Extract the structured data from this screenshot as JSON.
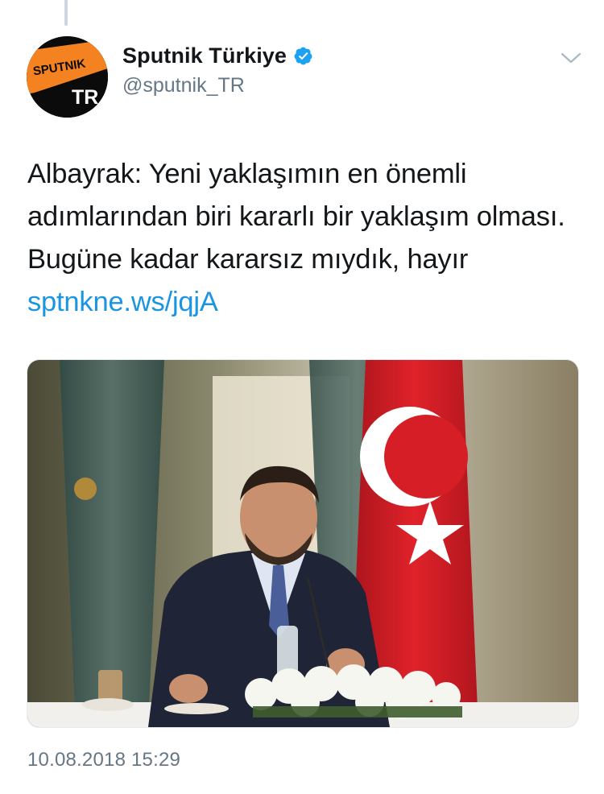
{
  "tweet": {
    "author": {
      "display_name": "Sputnik Türkiye",
      "handle": "@sputnik_TR",
      "verified": true,
      "avatar": {
        "logo_text": "SPUTNIK",
        "region_text": "TR",
        "brand_color": "#f58220"
      }
    },
    "text": "Albayrak: Yeni yaklaşımın en önemli adımlarından biri kararlı bir yaklaşım olması. Bugüne kadar kararsız mıydık, hayır",
    "link": "sptnkne.ws/jqjA",
    "timestamp": "10.08.2018 15:29",
    "media": {
      "type": "photo",
      "icon": "photo-icon"
    }
  },
  "colors": {
    "text_primary": "#14171a",
    "text_secondary": "#657786",
    "link": "#1b95e0",
    "verified": "#1da1f2"
  }
}
